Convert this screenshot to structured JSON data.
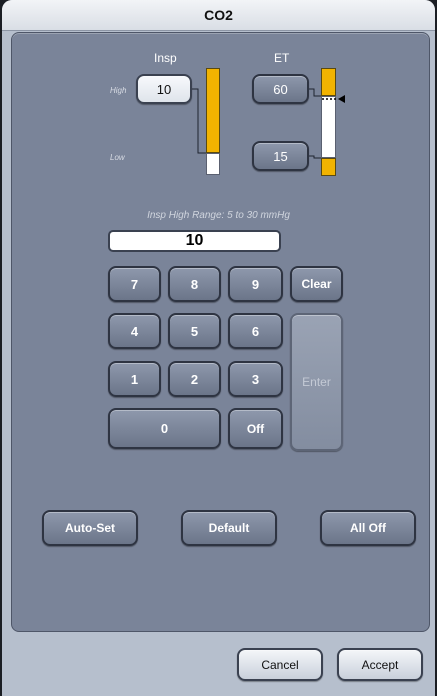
{
  "title": "CO2",
  "insp": {
    "label": "Insp",
    "high_label": "High",
    "low_label": "Low",
    "high_value": "10"
  },
  "et": {
    "label": "ET",
    "high_value": "60",
    "low_value": "15"
  },
  "range_text": "Insp High Range: 5 to 30 mmHg",
  "entry_value": "10",
  "keypad": {
    "k7": "7",
    "k8": "8",
    "k9": "9",
    "clear": "Clear",
    "k4": "4",
    "k5": "5",
    "k6": "6",
    "enter": "Enter",
    "k1": "1",
    "k2": "2",
    "k3": "3",
    "k0": "0",
    "off": "Off"
  },
  "actions": {
    "auto_set": "Auto-Set",
    "default": "Default",
    "all_off": "All Off"
  },
  "footer": {
    "cancel": "Cancel",
    "accept": "Accept"
  },
  "colors": {
    "accent_bar": "#f2b300",
    "panel": "#7a8499",
    "dialog": "#b6bfcd"
  }
}
